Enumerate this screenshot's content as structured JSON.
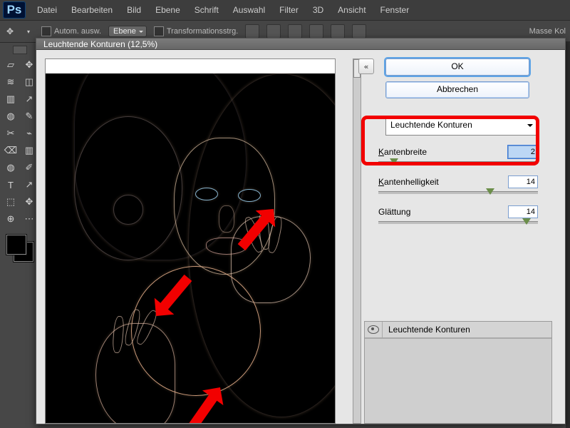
{
  "menubar": {
    "logo": "Ps",
    "items": [
      "Datei",
      "Bearbeiten",
      "Bild",
      "Ebene",
      "Schrift",
      "Auswahl",
      "Filter",
      "3D",
      "Ansicht",
      "Fenster"
    ]
  },
  "optionsbar": {
    "auto_check_label": "Autom. ausw.",
    "layer_dd": "Ebene",
    "transform_check_label": "Transformationsstrg.",
    "right_label": "Masse Kol"
  },
  "dialog": {
    "title": "Leuchtende Konturen (12,5%)",
    "ok": "OK",
    "cancel": "Abbrechen",
    "filter_dropdown": "Leuchtende Konturen",
    "params": {
      "kantenbreite": {
        "label_pre": "K",
        "label_rest": "antenbreite",
        "value": "2",
        "pos_pct": 10
      },
      "kantenhelligkeit": {
        "label_pre": "K",
        "label_rest": "antenhelligkeit",
        "value": "14",
        "pos_pct": 70
      },
      "glaettung": {
        "label": "Glättung",
        "value": "14",
        "pos_pct": 93
      }
    },
    "effect_layer": "Leuchtende Konturen"
  },
  "tools": {
    "icons": [
      "▱",
      "◫",
      "≋",
      "✎",
      "↗",
      "✂",
      "▥",
      "✐",
      "⌫",
      "⌁",
      "◍",
      "T",
      "◧",
      "✥",
      "⬚",
      "⊕",
      "↯",
      "⋯"
    ]
  }
}
